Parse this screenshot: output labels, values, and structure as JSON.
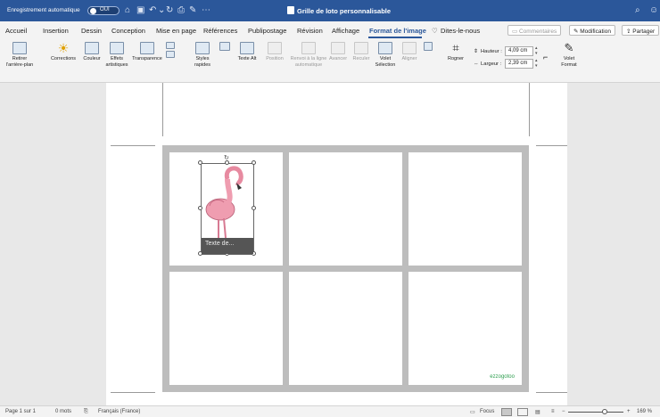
{
  "titlebar": {
    "autosave_label": "Enregistrement automatique",
    "autosave_state": "OUI",
    "doc_title": "Grille de loto personnalisable",
    "icons": [
      "home-icon",
      "save-icon",
      "undo-icon",
      "redo-icon",
      "print-icon",
      "edit-icon",
      "more-icon",
      "search-icon",
      "account-icon"
    ]
  },
  "tabs": [
    "Accueil",
    "Insertion",
    "Dessin",
    "Conception",
    "Mise en page",
    "Références",
    "Publipostage",
    "Révision",
    "Affichage",
    "Format de l'image",
    "Dites-le-nous"
  ],
  "active_tab": "Format de l'image",
  "tab_actions": {
    "comments": "Commentaires",
    "editing": "Modification",
    "share": "Partager"
  },
  "ribbon": {
    "remove_bg": "Retirer l'arrière-plan",
    "corrections": "Corrections",
    "color": "Couleur",
    "artistic": "Effets artistiques",
    "transparency": "Transparence",
    "quick_styles": "Styles rapides",
    "alt_text": "Texte Alt",
    "position": "Position",
    "wrap_text": "Renvoi à la ligne automatique",
    "bring_forward": "Avancer",
    "send_backward": "Reculer",
    "selection_pane": "Volet Sélection",
    "align": "Aligner",
    "crop": "Rogner",
    "height_label": "Hauteur :",
    "height_value": "4,09 cm",
    "width_label": "Largeur :",
    "width_value": "2,39 cm",
    "format_pane": "Volet Format"
  },
  "document": {
    "caption": "Texte de...",
    "watermark": "ezzogotoo"
  },
  "statusbar": {
    "page": "Page 1 sur 1",
    "words": "0 mots",
    "language": "Français (France)",
    "focus": "Focus",
    "zoom": "169 %"
  }
}
